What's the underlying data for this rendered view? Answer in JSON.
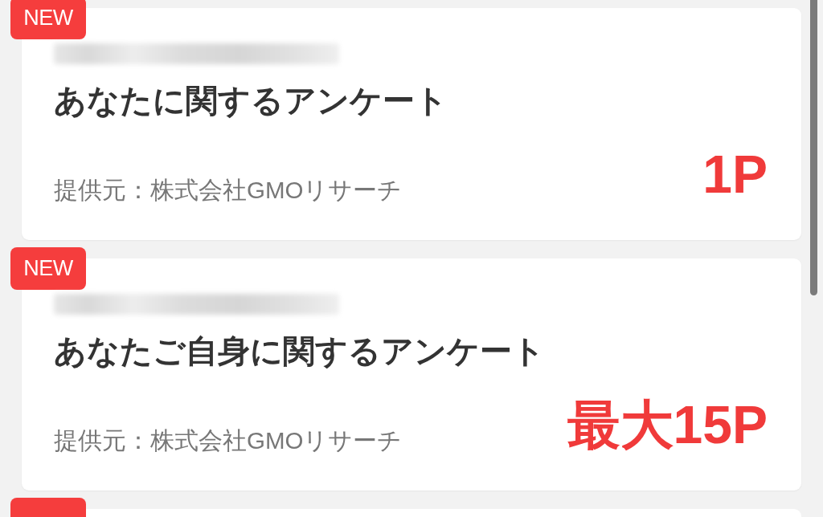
{
  "surveys": [
    {
      "badge": "NEW",
      "number_blurred": true,
      "title": "あなたに関するアンケート",
      "provider": "提供元：株式会社GMOリサーチ",
      "points": "1P"
    },
    {
      "badge": "NEW",
      "number_blurred": true,
      "title": "あなたご自身に関するアンケート",
      "provider": "提供元：株式会社GMOリサーチ",
      "points": "最大15P"
    },
    {
      "badge_cut": true
    }
  ]
}
